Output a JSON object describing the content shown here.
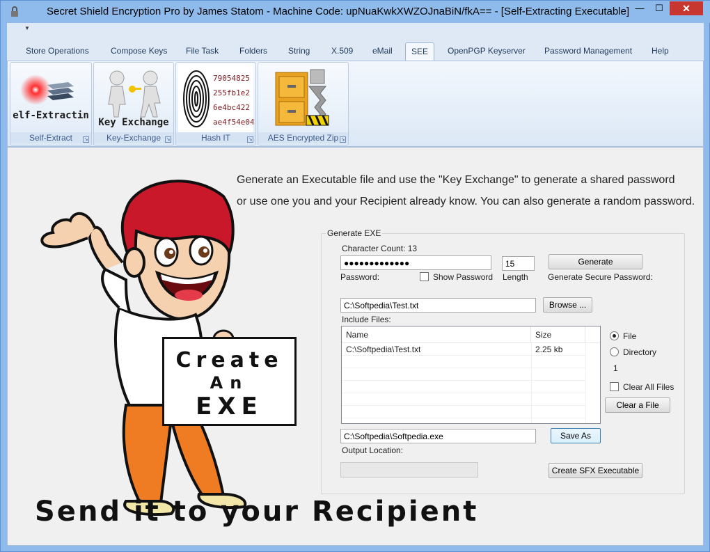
{
  "window": {
    "title": "Secret Shield Encryption Pro by James Statom - Machine Code: upNuaKwkXWZOJnaBiN/fkA== - [Self-Extracting Executable]",
    "minimize": "—",
    "maximize": "☐",
    "close": "✕"
  },
  "tabs": [
    {
      "label": "Store Operations"
    },
    {
      "label": "Compose Keys"
    },
    {
      "label": "File Task"
    },
    {
      "label": "Folders"
    },
    {
      "label": "String"
    },
    {
      "label": "X.509"
    },
    {
      "label": "eMail"
    },
    {
      "label": "SEE",
      "active": true
    },
    {
      "label": "OpenPGP Keyserver"
    },
    {
      "label": "Password Management"
    },
    {
      "label": "Help"
    }
  ],
  "ribbon": {
    "groups": [
      {
        "label": "Self-Extract",
        "button_text": "Self-Extracting",
        "icon": "self-extracting-icon"
      },
      {
        "label": "Key-Exchange",
        "button_text": "Key Exchange",
        "icon": "key-exchange-icon"
      },
      {
        "label": "Hash IT",
        "button_text": [
          "79054825",
          "255fb1e2",
          "6e4bc422",
          "ae4f54e04"
        ],
        "icon": "fingerprint-icon"
      },
      {
        "label": "AES Encrypted Zip",
        "icon": "zip-cabinet-icon"
      }
    ]
  },
  "content": {
    "intro_line1": "Generate an Executable file and use the \"Key Exchange\" to generate a shared password",
    "intro_line2": "or use one you and your Recipient already know. You can also generate a random password.",
    "sign_line1": "Create",
    "sign_line2": "An",
    "sign_line3": "EXE",
    "bottom_text": "Send it to your Recipient"
  },
  "form": {
    "group_title": "Generate EXE",
    "char_count_label": "Character Count: 13",
    "password_value": "●●●●●●●●●●●●●",
    "password_label": "Password:",
    "show_password_label": "Show Password",
    "length_value": "15",
    "length_label": "Length",
    "generate_button": "Generate",
    "generate_secure_label": "Generate Secure Password:",
    "file_path_value": "C:\\Softpedia\\Test.txt",
    "browse_button": "Browse ...",
    "include_files_label": "Include Files:",
    "list": {
      "columns": [
        "Name",
        "Size"
      ],
      "rows": [
        {
          "name": "C:\\Softpedia\\Test.txt",
          "size": "2.25 kb"
        }
      ]
    },
    "radio_file_label": "File",
    "radio_directory_label": "Directory",
    "count_value": "1",
    "clear_all_label": "Clear All Files",
    "clear_file_button": "Clear a File",
    "output_path_value": "C:\\Softpedia\\Softpedia.exe",
    "save_as_button": "Save As",
    "output_location_label": "Output Location:",
    "create_button": "Create SFX Executable"
  },
  "colors": {
    "window_frame": "#8fbbec",
    "close_button": "#c7372f",
    "hair": "#c8182a",
    "pants": "#ef7b22"
  }
}
